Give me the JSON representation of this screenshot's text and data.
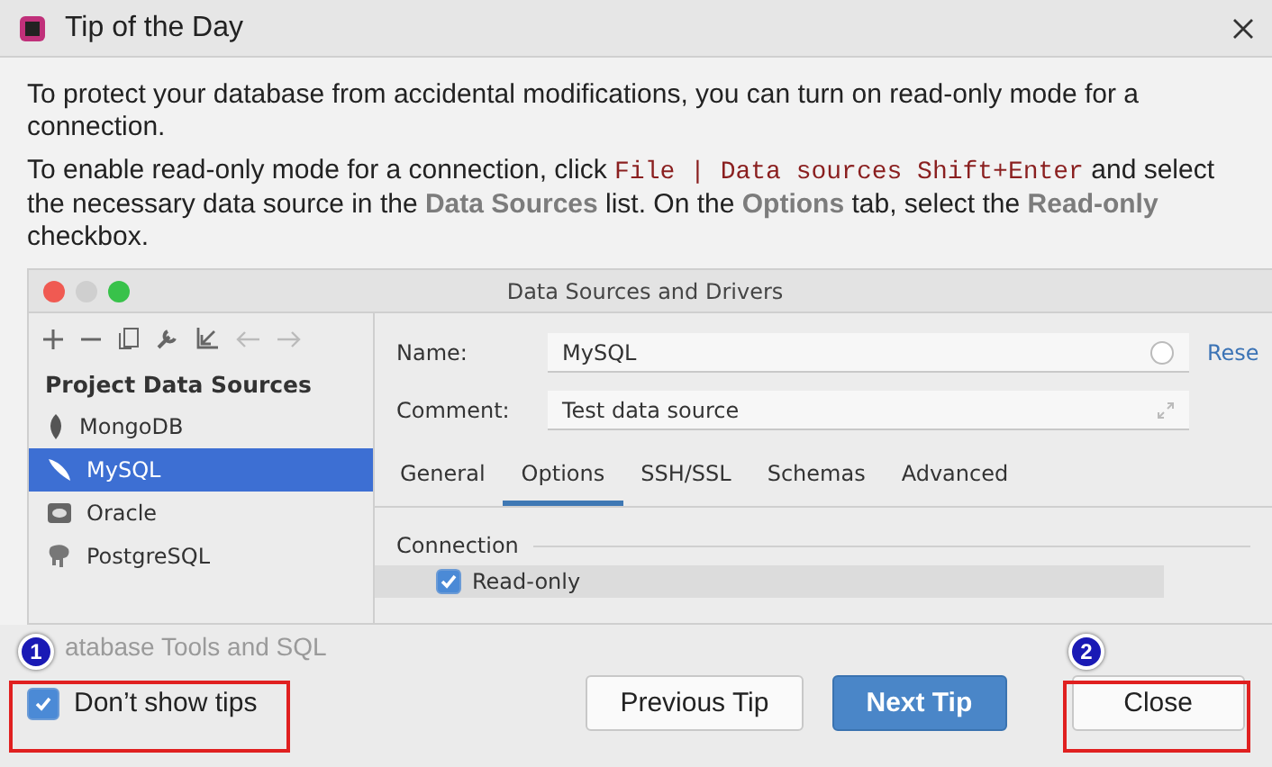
{
  "window": {
    "title": "Tip of the Day"
  },
  "tip": {
    "paragraphs": [
      [
        {
          "kind": "text",
          "text": "To protect your database from accidental modifications, you can turn on read-only mode for a connection."
        }
      ],
      [
        {
          "kind": "text",
          "text": "To enable read-only mode for a connection, click "
        },
        {
          "kind": "code",
          "text": "File | Data sources Shift+Enter"
        },
        {
          "kind": "text",
          "text": " and select the necessary data source in the "
        },
        {
          "kind": "ui",
          "text": "Data Sources"
        },
        {
          "kind": "text",
          "text": " list. On the "
        },
        {
          "kind": "ui",
          "text": "Options"
        },
        {
          "kind": "text",
          "text": " tab, select the "
        },
        {
          "kind": "ui",
          "text": "Read-only"
        },
        {
          "kind": "text",
          "text": " checkbox."
        }
      ]
    ]
  },
  "screenshot": {
    "title": "Data Sources and Drivers",
    "sidebar": {
      "heading": "Project Data Sources",
      "items": [
        {
          "label": "MongoDB",
          "kind": "leaf",
          "selected": false
        },
        {
          "label": "MySQL",
          "kind": "feather",
          "selected": true
        },
        {
          "label": "Oracle",
          "kind": "disk",
          "selected": false
        },
        {
          "label": "PostgreSQL",
          "kind": "elephant",
          "selected": false
        }
      ]
    },
    "name": {
      "label": "Name:",
      "value": "MySQL"
    },
    "comment": {
      "label": "Comment:",
      "value": "Test data source"
    },
    "reset_link": "Rese",
    "tabs": [
      {
        "label": "General",
        "selected": false
      },
      {
        "label": "Options",
        "selected": true
      },
      {
        "label": "SSH/SSL",
        "selected": false
      },
      {
        "label": "Schemas",
        "selected": false
      },
      {
        "label": "Advanced",
        "selected": false
      }
    ],
    "section": "Connection",
    "read_only": {
      "label": "Read-only",
      "checked": true
    },
    "next_section": "atabase Tools and SQL"
  },
  "footer": {
    "dont_show": {
      "label": "Don’t show tips",
      "checked": true
    },
    "buttons": [
      {
        "label": "Previous Tip",
        "kind": "default"
      },
      {
        "label": "Next Tip",
        "kind": "primary"
      },
      {
        "label": "Close",
        "kind": "default"
      }
    ]
  },
  "annotations": [
    "1",
    "2"
  ]
}
